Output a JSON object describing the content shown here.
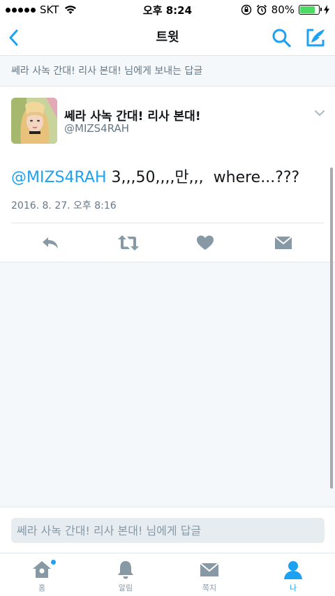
{
  "status_bar": {
    "carrier": "SKT",
    "time": "오후 8:24",
    "battery_percent": "80%",
    "battery_level": 0.8
  },
  "nav": {
    "title": "트윗",
    "back_icon": "chevron-left-icon",
    "search_icon": "search-icon",
    "compose_icon": "compose-icon"
  },
  "reply_banner": "쎄라 사녹 간대! 리사 본대! 님에게 보내는 답글",
  "tweet": {
    "display_name": "쎄라 사녹 간대! 리사 본대!",
    "handle": "@MIZS4RAH",
    "mention": "@MIZS4RAH",
    "body": " 3,,,50,,,,만,,,  where...???",
    "timestamp": "2016. 8. 27. 오후 8:16"
  },
  "composer": {
    "placeholder": "쎄라 사녹 간대! 리사 본대! 님에게 답글"
  },
  "tabs": [
    {
      "label": "홈",
      "icon": "home-icon",
      "active": false
    },
    {
      "label": "알림",
      "icon": "bell-icon",
      "active": false
    },
    {
      "label": "쪽지",
      "icon": "envelope-icon",
      "active": false
    },
    {
      "label": "나",
      "icon": "person-icon",
      "active": true
    }
  ],
  "colors": {
    "accent": "#1da1f2",
    "icon_gray": "#8899a6",
    "battery": "#4cd964"
  }
}
